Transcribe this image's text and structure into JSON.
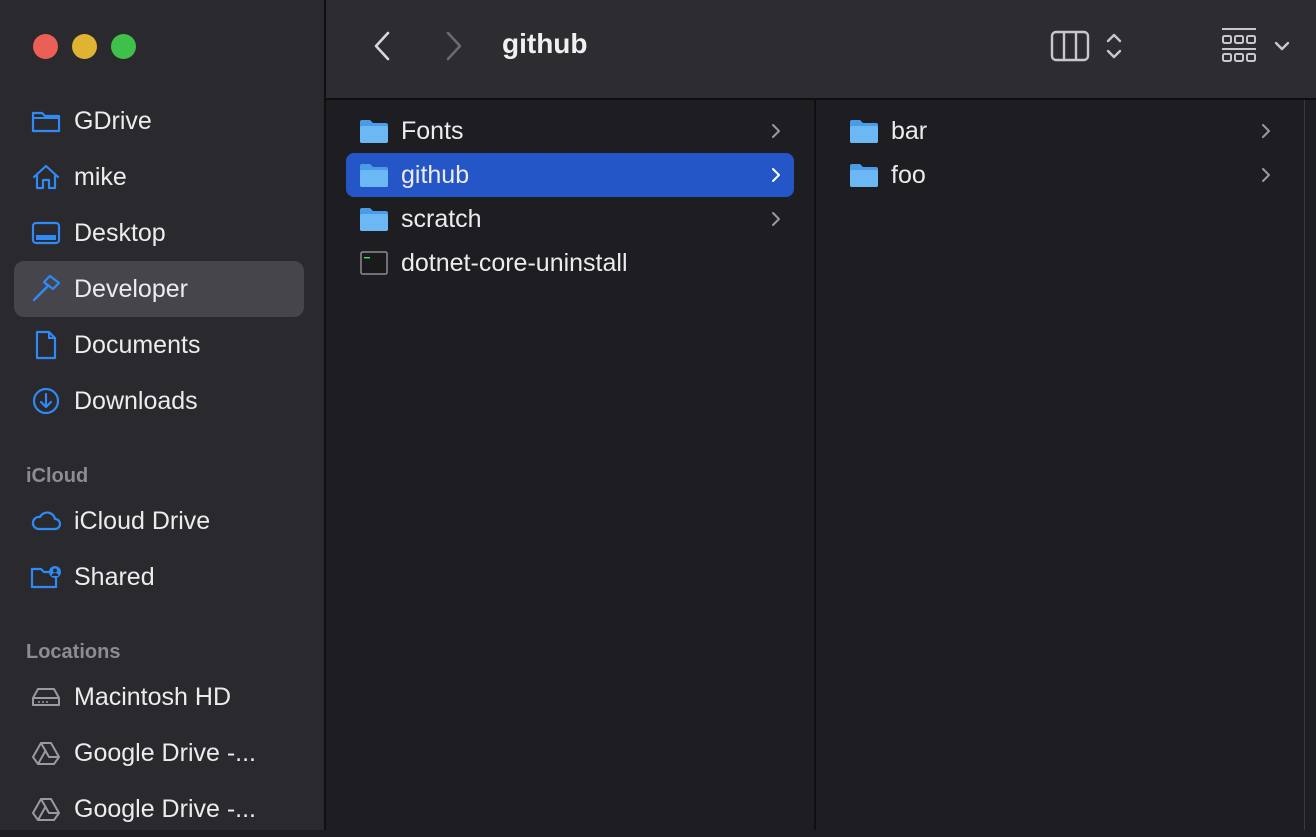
{
  "window": {
    "title": "github"
  },
  "colors": {
    "selection": "#2456c8",
    "sidebar_selected": "#46454b",
    "accent_icon": "#2f8af5",
    "folder": "#5aaef0"
  },
  "sidebar": {
    "favorites": [
      {
        "label": "GDrive",
        "icon": "folder-icon"
      },
      {
        "label": "mike",
        "icon": "home-icon"
      },
      {
        "label": "Desktop",
        "icon": "desktop-icon"
      },
      {
        "label": "Developer",
        "icon": "hammer-icon",
        "selected": true
      },
      {
        "label": "Documents",
        "icon": "document-icon"
      },
      {
        "label": "Downloads",
        "icon": "download-icon"
      }
    ],
    "icloud_header": "iCloud",
    "icloud": [
      {
        "label": "iCloud Drive",
        "icon": "cloud-icon"
      },
      {
        "label": "Shared",
        "icon": "shared-folder-icon"
      }
    ],
    "locations_header": "Locations",
    "locations": [
      {
        "label": "Macintosh HD",
        "icon": "disk-icon"
      },
      {
        "label": "Google Drive -...",
        "icon": "google-drive-icon"
      },
      {
        "label": "Google Drive -...",
        "icon": "google-drive-icon"
      }
    ]
  },
  "columns": [
    {
      "items": [
        {
          "label": "Fonts",
          "type": "folder"
        },
        {
          "label": "github",
          "type": "folder",
          "selected": true
        },
        {
          "label": "scratch",
          "type": "folder"
        },
        {
          "label": "dotnet-core-uninstall",
          "type": "executable"
        }
      ]
    },
    {
      "items": [
        {
          "label": "bar",
          "type": "folder"
        },
        {
          "label": "foo",
          "type": "folder"
        }
      ]
    }
  ]
}
